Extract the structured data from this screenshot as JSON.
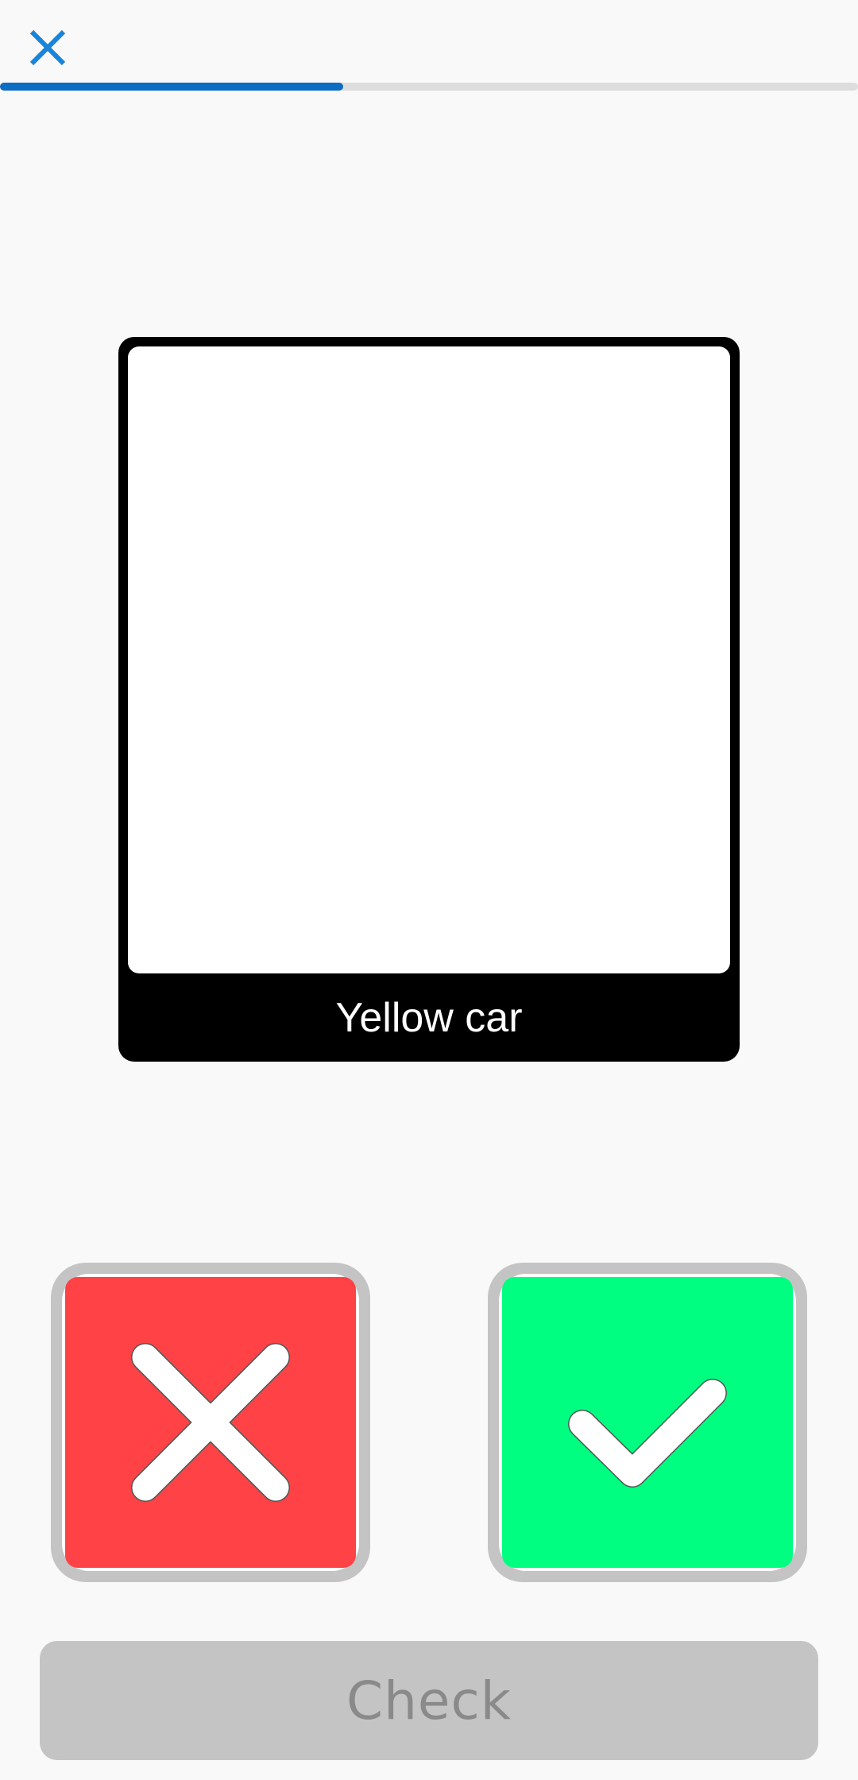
{
  "header": {
    "close_icon": "close-icon",
    "progress": 0.4,
    "progress_color": "#0a6dc2",
    "close_color": "#1a84d8"
  },
  "card": {
    "label": "Yellow car"
  },
  "answers": {
    "no_icon": "x-icon",
    "no_color": "#ff4245",
    "yes_icon": "check-icon",
    "yes_color": "#00ff80"
  },
  "footer": {
    "check_label": "Check"
  }
}
